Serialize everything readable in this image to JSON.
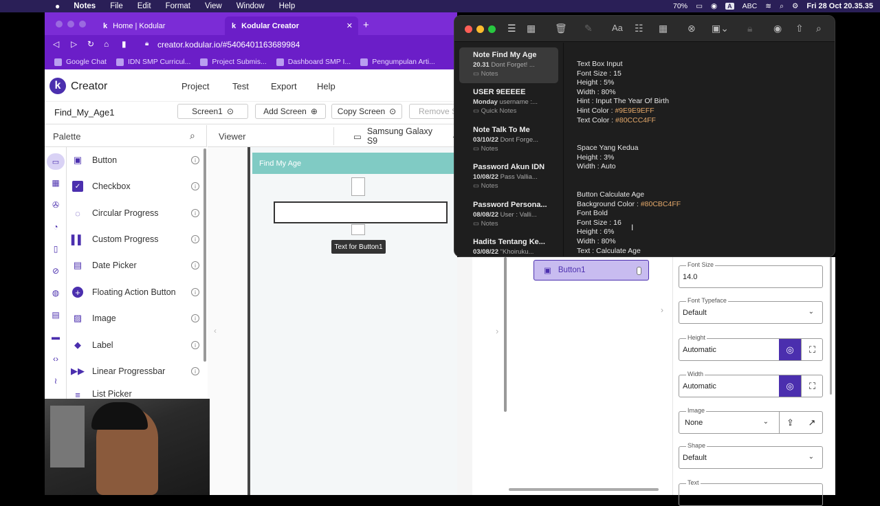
{
  "menubar": {
    "app": "Notes",
    "items": [
      "File",
      "Edit",
      "Format",
      "View",
      "Window",
      "Help"
    ],
    "battery": "70%",
    "input_source": "ABC",
    "datetime": "Fri 28 Oct 20.35.35"
  },
  "browser": {
    "tabs": [
      {
        "label": "Home | Kodular"
      },
      {
        "label": "Kodular Creator"
      }
    ],
    "url": "creator.kodular.io/#5406401163689984",
    "bookmarks": [
      "Google Chat",
      "IDN SMP Curricul...",
      "Project Submis...",
      "Dashboard SMP I...",
      "Pengumpulan Arti..."
    ]
  },
  "creator": {
    "logo_text": "Creator",
    "nav": [
      "Project",
      "Test",
      "Export",
      "Help"
    ],
    "project_name": "Find_My_Age1",
    "screen_select": "Screen1",
    "add_screen": "Add Screen",
    "copy_screen": "Copy Screen",
    "remove_screen": "Remove S",
    "palette_title": "Palette",
    "viewer_title": "Viewer",
    "device": "Samsung Galaxy S9",
    "palette_items": [
      "Button",
      "Checkbox",
      "Circular Progress",
      "Custom Progress",
      "Date Picker",
      "Floating Action Button",
      "Image",
      "Label",
      "Linear Progressbar",
      "List Picker"
    ],
    "app_title": "Find My Age",
    "tooltip": "Text for Button1",
    "component": "Button1",
    "properties": [
      {
        "label": "Font Size",
        "value": "14.0"
      },
      {
        "label": "Font Typeface",
        "value": "Default"
      },
      {
        "label": "Height",
        "value": "Automatic"
      },
      {
        "label": "Width",
        "value": "Automatic"
      },
      {
        "label": "Image",
        "value": "None"
      },
      {
        "label": "Shape",
        "value": "Default"
      },
      {
        "label": "Text",
        "value": ""
      }
    ]
  },
  "notes": {
    "list": [
      {
        "title": "Note Find My Age",
        "date": "20.31",
        "preview": "Dont Forget! ...",
        "folder": "Notes"
      },
      {
        "title": "USER 9EEEEE",
        "date": "Monday",
        "preview": "username :...",
        "folder": "Quick Notes"
      },
      {
        "title": "Note Talk To Me",
        "date": "03/10/22",
        "preview": "Dont Forge...",
        "folder": "Notes"
      },
      {
        "title": "Password Akun IDN",
        "date": "10/08/22",
        "preview": "Pass Vallia...",
        "folder": "Notes"
      },
      {
        "title": "Password Persona...",
        "date": "08/08/22",
        "preview": "User : Valli...",
        "folder": "Notes"
      },
      {
        "title": "Hadits Tentang Ke...",
        "date": "03/08/22",
        "preview": "\"Khoiruku...",
        "folder": ""
      }
    ],
    "body": {
      "block1": [
        "Text Box Input",
        "Font Size : 15",
        "Height : 5%",
        "Width : 80%",
        "Hint : Input The Year Of Birth"
      ],
      "hint_color_label": "Hint Color : ",
      "hint_color": "#9E9E9EFF",
      "text_color_label": "Text Color : ",
      "text_color": "#80CCC4FF",
      "block2": [
        "Space Yang Kedua",
        "Height : 3%",
        "Width : Auto"
      ],
      "block3_title": "Button Calculate Age",
      "bg_label": "Background Color : ",
      "bg_color": "#80CBC4FF",
      "block3": [
        "Font Bold",
        "Font Size : 16",
        "Height : 6%",
        "Width : 80%",
        "Text : Calculate Age"
      ]
    }
  },
  "colors": {
    "menubar": "#2a1f57",
    "browser": "#6b1ec8",
    "accent": "#4b2fae",
    "appbar": "#80cbc4"
  }
}
